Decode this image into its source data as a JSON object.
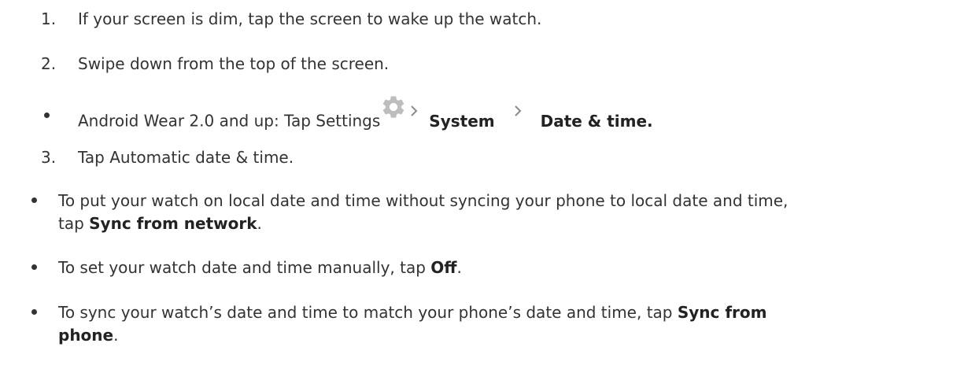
{
  "steps": {
    "step1": {
      "number": "1.",
      "text": "If your screen is dim, tap the screen to wake up the watch."
    },
    "step2": {
      "number": "2.",
      "text": "Swipe down from the top of the screen."
    },
    "sub_bullet": {
      "prefix": "Android Wear 2.0 and up: Tap Settings",
      "system": "System",
      "date_time": "Date & time.",
      "icons": [
        "gear-icon",
        "chevron-right-icon",
        "chevron-right-icon"
      ]
    },
    "step3": {
      "number": "3.",
      "text": "Tap Automatic date & time."
    }
  },
  "options": [
    {
      "line1": "To put your watch on local date and time without syncing your phone to local date and time,",
      "line2_prefix": "tap ",
      "bold": "Sync from network",
      "suffix": "."
    },
    {
      "prefix": "To set your watch date and time manually, tap ",
      "bold": "Off",
      "suffix": "."
    },
    {
      "line1_prefix": "To sync your watch’s date and time to match your phone’s date and time, tap ",
      "bold_line1": "Sync from",
      "bold_line2": "phone",
      "suffix": "."
    }
  ],
  "colors": {
    "text": "#333333",
    "icon": "#bdbdbd"
  }
}
